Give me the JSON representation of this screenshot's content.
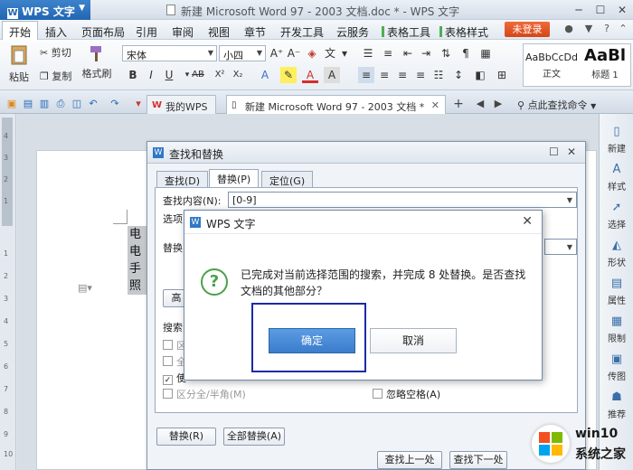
{
  "app": {
    "name": "WPS 文字",
    "window_title": "新建 Microsoft Word 97 - 2003 文档.doc * - WPS 文字"
  },
  "menu": {
    "items": [
      "开始",
      "插入",
      "页面布局",
      "引用",
      "审阅",
      "视图",
      "章节",
      "开发工具",
      "云服务",
      "表格工具",
      "表格样式"
    ],
    "login": "未登录"
  },
  "ribbon": {
    "paste": "粘贴",
    "cut": "剪切",
    "copy": "复制",
    "format_painter": "格式刷",
    "font": "宋体",
    "size": "小四",
    "styles": [
      {
        "preview": "AaBbCcDd",
        "label": "正文"
      },
      {
        "preview": "AaBl",
        "label": "标题 1"
      }
    ]
  },
  "tabs": {
    "my_wps": "我的WPS",
    "doc": "新建 Microsoft Word 97 - 2003 文档 *",
    "search_cmd": "点此查找命令"
  },
  "document": {
    "lines": [
      "电话",
      "电话",
      "手机",
      "照片"
    ]
  },
  "sidebar": {
    "items": [
      "新建",
      "样式",
      "选择",
      "形状",
      "属性",
      "限制",
      "传图",
      "推荐"
    ]
  },
  "find_replace": {
    "title": "查找和替换",
    "tabs": [
      "查找(D)",
      "替换(P)",
      "定位(G)"
    ],
    "find_label": "查找内容(N):",
    "find_value": "[0-9]",
    "options_label": "选项",
    "replace_label": "替换",
    "advanced_btn": "高",
    "search_label": "搜索",
    "options": [
      {
        "label": "区分全/半角(M)",
        "checked": false
      },
      {
        "label": "忽略空格(A)",
        "checked": false
      }
    ],
    "opt_short": [
      "区",
      "全",
      "使"
    ],
    "replace_btn": "替换(R)",
    "replace_all_btn": "全部替换(A)",
    "find_prev_btn": "查找上一处(B)",
    "find_next_btn": "查找下一处"
  },
  "message": {
    "title": "WPS 文字",
    "text": "已完成对当前选择范围的搜索，并完成 8 处替换。是否查找文档的其他部分？",
    "ok": "确定",
    "cancel": "取消"
  },
  "watermark": {
    "line1": "win10",
    "line2": "系统之家"
  }
}
